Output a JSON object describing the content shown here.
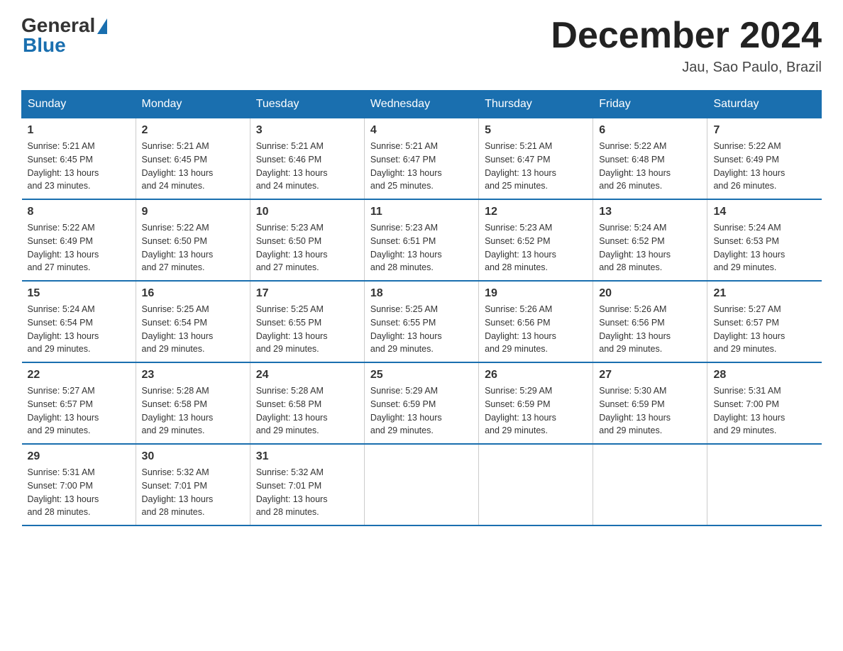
{
  "logo": {
    "general": "General",
    "blue": "Blue"
  },
  "header": {
    "month": "December 2024",
    "location": "Jau, Sao Paulo, Brazil"
  },
  "weekdays": [
    "Sunday",
    "Monday",
    "Tuesday",
    "Wednesday",
    "Thursday",
    "Friday",
    "Saturday"
  ],
  "weeks": [
    [
      {
        "day": "1",
        "sunrise": "5:21 AM",
        "sunset": "6:45 PM",
        "daylight": "13 hours and 23 minutes."
      },
      {
        "day": "2",
        "sunrise": "5:21 AM",
        "sunset": "6:45 PM",
        "daylight": "13 hours and 24 minutes."
      },
      {
        "day": "3",
        "sunrise": "5:21 AM",
        "sunset": "6:46 PM",
        "daylight": "13 hours and 24 minutes."
      },
      {
        "day": "4",
        "sunrise": "5:21 AM",
        "sunset": "6:47 PM",
        "daylight": "13 hours and 25 minutes."
      },
      {
        "day": "5",
        "sunrise": "5:21 AM",
        "sunset": "6:47 PM",
        "daylight": "13 hours and 25 minutes."
      },
      {
        "day": "6",
        "sunrise": "5:22 AM",
        "sunset": "6:48 PM",
        "daylight": "13 hours and 26 minutes."
      },
      {
        "day": "7",
        "sunrise": "5:22 AM",
        "sunset": "6:49 PM",
        "daylight": "13 hours and 26 minutes."
      }
    ],
    [
      {
        "day": "8",
        "sunrise": "5:22 AM",
        "sunset": "6:49 PM",
        "daylight": "13 hours and 27 minutes."
      },
      {
        "day": "9",
        "sunrise": "5:22 AM",
        "sunset": "6:50 PM",
        "daylight": "13 hours and 27 minutes."
      },
      {
        "day": "10",
        "sunrise": "5:23 AM",
        "sunset": "6:50 PM",
        "daylight": "13 hours and 27 minutes."
      },
      {
        "day": "11",
        "sunrise": "5:23 AM",
        "sunset": "6:51 PM",
        "daylight": "13 hours and 28 minutes."
      },
      {
        "day": "12",
        "sunrise": "5:23 AM",
        "sunset": "6:52 PM",
        "daylight": "13 hours and 28 minutes."
      },
      {
        "day": "13",
        "sunrise": "5:24 AM",
        "sunset": "6:52 PM",
        "daylight": "13 hours and 28 minutes."
      },
      {
        "day": "14",
        "sunrise": "5:24 AM",
        "sunset": "6:53 PM",
        "daylight": "13 hours and 29 minutes."
      }
    ],
    [
      {
        "day": "15",
        "sunrise": "5:24 AM",
        "sunset": "6:54 PM",
        "daylight": "13 hours and 29 minutes."
      },
      {
        "day": "16",
        "sunrise": "5:25 AM",
        "sunset": "6:54 PM",
        "daylight": "13 hours and 29 minutes."
      },
      {
        "day": "17",
        "sunrise": "5:25 AM",
        "sunset": "6:55 PM",
        "daylight": "13 hours and 29 minutes."
      },
      {
        "day": "18",
        "sunrise": "5:25 AM",
        "sunset": "6:55 PM",
        "daylight": "13 hours and 29 minutes."
      },
      {
        "day": "19",
        "sunrise": "5:26 AM",
        "sunset": "6:56 PM",
        "daylight": "13 hours and 29 minutes."
      },
      {
        "day": "20",
        "sunrise": "5:26 AM",
        "sunset": "6:56 PM",
        "daylight": "13 hours and 29 minutes."
      },
      {
        "day": "21",
        "sunrise": "5:27 AM",
        "sunset": "6:57 PM",
        "daylight": "13 hours and 29 minutes."
      }
    ],
    [
      {
        "day": "22",
        "sunrise": "5:27 AM",
        "sunset": "6:57 PM",
        "daylight": "13 hours and 29 minutes."
      },
      {
        "day": "23",
        "sunrise": "5:28 AM",
        "sunset": "6:58 PM",
        "daylight": "13 hours and 29 minutes."
      },
      {
        "day": "24",
        "sunrise": "5:28 AM",
        "sunset": "6:58 PM",
        "daylight": "13 hours and 29 minutes."
      },
      {
        "day": "25",
        "sunrise": "5:29 AM",
        "sunset": "6:59 PM",
        "daylight": "13 hours and 29 minutes."
      },
      {
        "day": "26",
        "sunrise": "5:29 AM",
        "sunset": "6:59 PM",
        "daylight": "13 hours and 29 minutes."
      },
      {
        "day": "27",
        "sunrise": "5:30 AM",
        "sunset": "6:59 PM",
        "daylight": "13 hours and 29 minutes."
      },
      {
        "day": "28",
        "sunrise": "5:31 AM",
        "sunset": "7:00 PM",
        "daylight": "13 hours and 29 minutes."
      }
    ],
    [
      {
        "day": "29",
        "sunrise": "5:31 AM",
        "sunset": "7:00 PM",
        "daylight": "13 hours and 28 minutes."
      },
      {
        "day": "30",
        "sunrise": "5:32 AM",
        "sunset": "7:01 PM",
        "daylight": "13 hours and 28 minutes."
      },
      {
        "day": "31",
        "sunrise": "5:32 AM",
        "sunset": "7:01 PM",
        "daylight": "13 hours and 28 minutes."
      },
      null,
      null,
      null,
      null
    ]
  ],
  "labels": {
    "sunrise": "Sunrise:",
    "sunset": "Sunset:",
    "daylight": "Daylight:"
  }
}
